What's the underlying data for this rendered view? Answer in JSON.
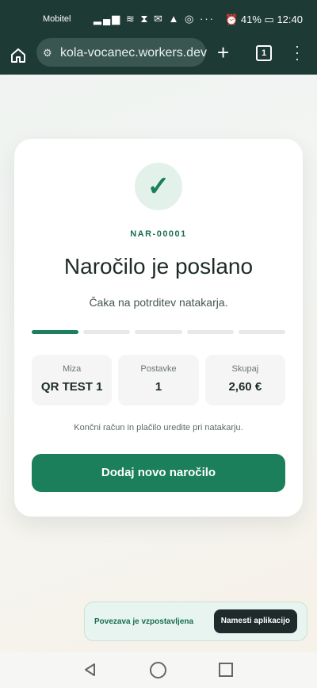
{
  "status_bar": {
    "carrier": "Mobitel",
    "battery": "41%",
    "time": "12:40"
  },
  "browser": {
    "url": "kola-vocanec.workers.dev",
    "tab_count": "1",
    "icons": [
      "home-icon",
      "site-settings-icon",
      "new-tab-icon",
      "tabs-icon",
      "menu-icon"
    ]
  },
  "order": {
    "id": "NAR-00001",
    "title": "Naročilo je poslano",
    "subtitle": "Čaka na potrditev natakarja.",
    "progress": {
      "completed_steps": 1,
      "total_steps": 5
    },
    "stats": [
      {
        "label": "Miza",
        "value": "QR TEST 1"
      },
      {
        "label": "Postavke",
        "value": "1"
      },
      {
        "label": "Skupaj",
        "value": "2,60 €"
      }
    ],
    "note": "Končni račun in plačilo uredite pri natakarju.",
    "cta_label": "Dodaj novo naročilo"
  },
  "toast": {
    "message": "Povezava je vzpostavljena",
    "button_label": "Namesti aplikacijo"
  },
  "colors": {
    "accent": "#1a7f5a",
    "header": "#1e3a34",
    "toast_button": "#1e2b2a"
  }
}
